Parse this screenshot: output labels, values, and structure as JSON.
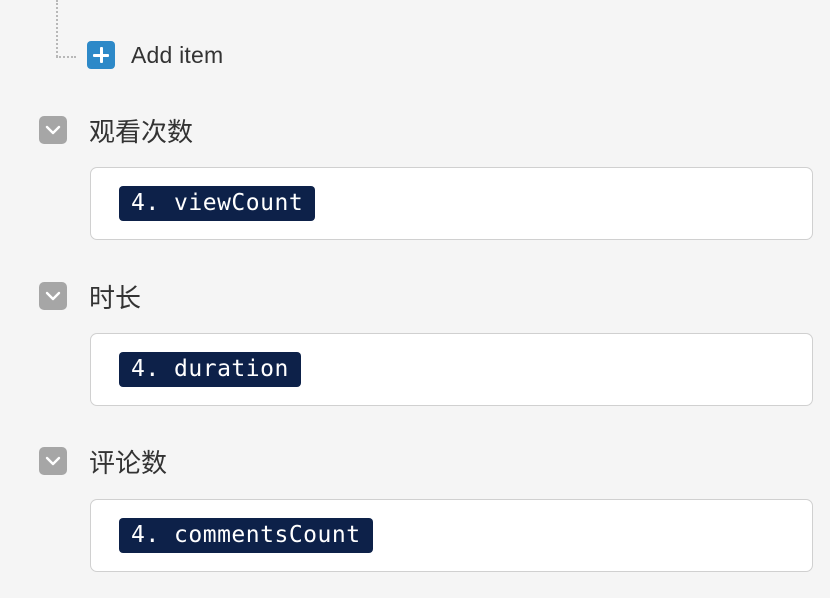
{
  "add_item": {
    "label": "Add item"
  },
  "fields": [
    {
      "title": "观看次数",
      "token": "4. viewCount"
    },
    {
      "title": "时长",
      "token": "4. duration"
    },
    {
      "title": "评论数",
      "token": "4. commentsCount"
    }
  ],
  "colors": {
    "add_icon": "#2d89c8",
    "toggle": "#a6a6a6",
    "token_bg": "#0d2149",
    "background": "#f5f5f5"
  },
  "icons": {
    "add": "plus-icon",
    "toggle": "chevron-down-icon"
  }
}
